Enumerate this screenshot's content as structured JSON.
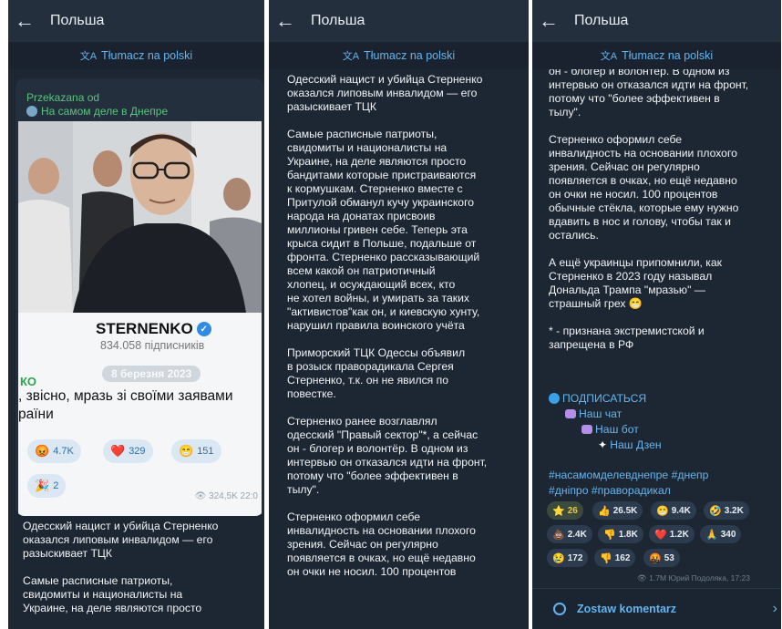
{
  "app": {
    "chat_title": "Польша",
    "translate_label": "Tłumacz na polski",
    "back_icon": "arrow-left-icon",
    "translate_icon": "translate-icon"
  },
  "panel1": {
    "forwarded_label": "Przekazana od",
    "forwarded_source": "На самом деле в Днепре",
    "card": {
      "channel_name": "STERNENKO",
      "subscribers": "834.058 підписників",
      "ko": "КО",
      "date": "8 березня 2023",
      "quote": ", звісно, мразь зі своїми заявами\nраїни",
      "reactions": [
        {
          "emoji": "😡",
          "count": "4.7K"
        },
        {
          "emoji": "❤️",
          "count": "329"
        },
        {
          "emoji": "😁",
          "count": "151"
        },
        {
          "emoji": "🎉",
          "count": "2"
        }
      ],
      "views": "👁 324,5K 22:0"
    },
    "text": "Одесский нацист и убийца Стерненко\nоказался липовым инвалидом — его\nразыскивает ТЦК\n\nСамые расписные патриоты,\nсвидомиты и националисты на\nУкраине, на деле являются просто"
  },
  "panel2": {
    "text": "Одесский нацист и убийца Стерненко\nоказался липовым инвалидом — его\nразыскивает ТЦК\n\nСамые расписные патриоты,\nсвидомиты и националисты на\nУкраине, на деле являются просто\nбандитами которые пристраиваются\nк кормушкам. Стерненко вместе с\nПритулой обманул кучу украинского\nнарода на донатах присвоив\nмиллионы гривен себе. Теперь эта\nкрыса сидит в Польше, подальше от\nфронта. Стерненко рассказывающий\nвсем какой он патриотичный\nхлопец, и осуждающий всех, кто\nне хотел войны, и умирать за таких\n\"активистов\"как он, и киевскую хунту,\nнарушил правила воинского учёта\n\nПриморский ТЦК Одессы объявил\nв розыск праворадикала Сергея\nСтерненко, т.к. он не явился по\nповестке.\n\nСтерненко ранее возглавлял\nодесский \"Правый сектор\"*, а сейчас\nон - блогер и волонтёр. В одном из\nинтервью он отказался идти на фронт,\nпотому что \"более эффективен в\nтылу\".\n\nСтерненко оформил себе\nинвалидность на основании плохого\nзрения. Сейчас он регулярно\nпоявляется в очках, но ещё недавно\nон очки не носил. 100 процентов"
  },
  "panel3": {
    "text": "он - блогер и волонтёр. В одном из\nинтервью он отказался идти на фронт,\nпотому что \"более эффективен в\nтылу\".\n\nСтерненко оформил себе\nинвалидность на основании плохого\nзрения. Сейчас он регулярно\nпоявляется в очках, но ещё недавно\nон очки не носил. 100 процентов\nобычные стёкла, которые ему нужно\nвдавить в нос и голову, чтобы так и\nостались.\n\nА ещё украинцы припомнили, как\nСтерненко в 2023 году называл\nДональда Трампа \"мразью\" —\nстрашный грех 😁\n\n* - признана экстремистской и\nзапрещена в РФ",
    "subscribe": "ПОДПИСАТЬСЯ",
    "links": [
      "Наш чат",
      "Наш бот",
      "Наш Дзен"
    ],
    "hashtags": "#насамомделевднепре #днепр\n#днiпро #праворадикал",
    "reactions": [
      {
        "emoji": "⭐",
        "count": "26"
      },
      {
        "emoji": "👍",
        "count": "26.5K"
      },
      {
        "emoji": "😁",
        "count": "9.4K"
      },
      {
        "emoji": "🤣",
        "count": "3.2K"
      },
      {
        "emoji": "💩",
        "count": "2.4K"
      },
      {
        "emoji": "👎",
        "count": "1.8K"
      },
      {
        "emoji": "❤️",
        "count": "1.2K"
      },
      {
        "emoji": "🙏",
        "count": "340"
      },
      {
        "emoji": "😢",
        "count": "172"
      },
      {
        "emoji": "👎",
        "count": "162"
      },
      {
        "emoji": "🤬",
        "count": "53"
      }
    ],
    "views": "👁 1.7M  Юрий Подоляка, 17:23",
    "comment_label": "Zostaw komentarz"
  }
}
